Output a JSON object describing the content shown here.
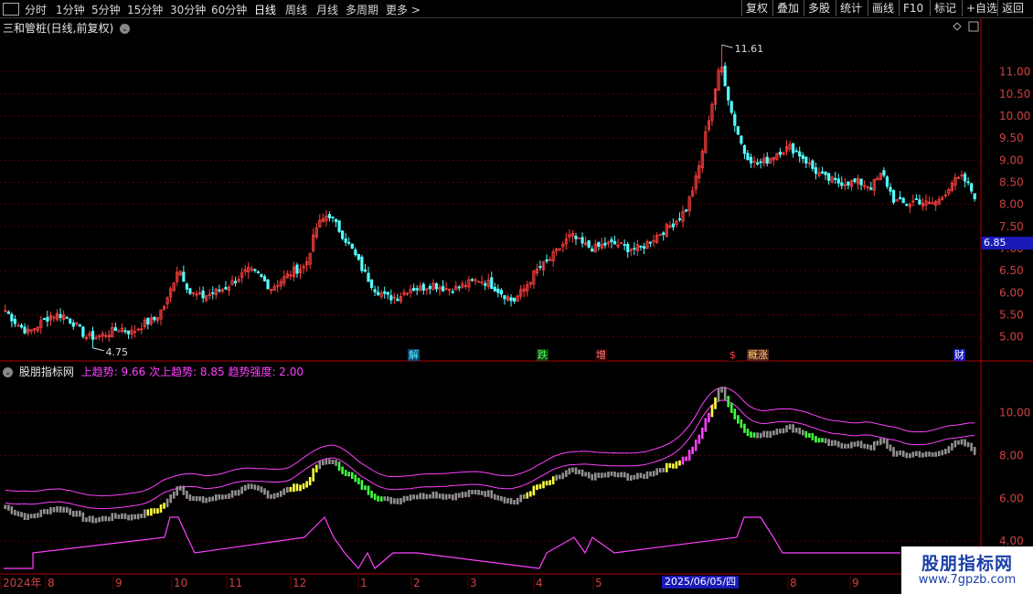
{
  "toolbar": {
    "periods": [
      "分时",
      "1分钟",
      "5分钟",
      "15分钟",
      "30分钟",
      "60分钟",
      "日线",
      "周线",
      "月线",
      "多周期",
      "更多 >"
    ],
    "active_period": "日线",
    "right_buttons": [
      "复权",
      "叠加",
      "多股",
      "统计",
      "画线",
      "F10",
      "标记",
      "+自选",
      "返回"
    ]
  },
  "main_chart": {
    "title": "三和管桩(日线,前复权)",
    "y_ticks": [
      "11.00",
      "10.50",
      "10.00",
      "9.50",
      "9.00",
      "8.50",
      "8.00",
      "7.50",
      "7.00",
      "6.50",
      "6.00",
      "5.50",
      "5.00"
    ],
    "current_price": "6.85",
    "high_label": "11.61",
    "low_label": "4.75",
    "markers": [
      "解",
      "跌",
      "增",
      "$",
      "概涨",
      "财"
    ]
  },
  "indicator": {
    "name": "股朋指标网",
    "values_text": "上趋势: 9.66 次上趋势: 8.85 趋势强度: 2.00",
    "y_ticks": [
      "10.00",
      "8.00",
      "6.00",
      "4.00"
    ]
  },
  "x_axis": {
    "labels": [
      "2024年",
      "8",
      "9",
      "10",
      "11",
      "12",
      "1",
      "2",
      "3",
      "4",
      "5",
      "6",
      "8",
      "9"
    ],
    "selected_date": "2025/06/05/四"
  },
  "colors": {
    "up": "#ff4040",
    "down": "#54ffff",
    "ma_upper": "#ff40ff",
    "ma_lower": "#ff40ff"
  },
  "watermark": {
    "line1": "股朋指标网",
    "line2": "www.7gpzb.com"
  },
  "chart_data": {
    "type": "candlestick",
    "title": "三和管桩(日线,前复权)",
    "x_range": [
      "2024-07",
      "2025-09"
    ],
    "ylim": [
      4.6,
      11.8
    ],
    "close_series_approx": [
      5.6,
      5.3,
      5.1,
      5.3,
      5.5,
      5.5,
      5.3,
      5.0,
      5.0,
      5.1,
      5.2,
      5.1,
      5.3,
      5.4,
      5.8,
      6.6,
      6.0,
      5.9,
      6.0,
      6.1,
      6.3,
      6.5,
      6.4,
      6.1,
      6.3,
      6.5,
      6.6,
      7.5,
      7.8,
      7.4,
      7.0,
      6.5,
      6.1,
      5.9,
      5.9,
      6.1,
      6.1,
      6.2,
      6.1,
      6.1,
      6.2,
      6.3,
      6.2,
      6.0,
      5.8,
      6.1,
      6.5,
      6.7,
      7.0,
      7.3,
      7.1,
      7.0,
      7.1,
      7.1,
      7.0,
      7.0,
      7.2,
      7.4,
      7.6,
      7.9,
      8.7,
      10.0,
      11.2,
      10.0,
      9.2,
      8.9,
      9.0,
      9.2,
      9.3,
      9.1,
      8.8,
      8.6,
      8.5,
      8.5,
      8.5,
      8.4,
      8.7,
      8.1,
      8.0,
      8.1,
      8.0,
      8.1,
      8.5,
      8.6,
      8.2
    ],
    "high": 11.61,
    "low": 4.75,
    "last": 6.85
  }
}
